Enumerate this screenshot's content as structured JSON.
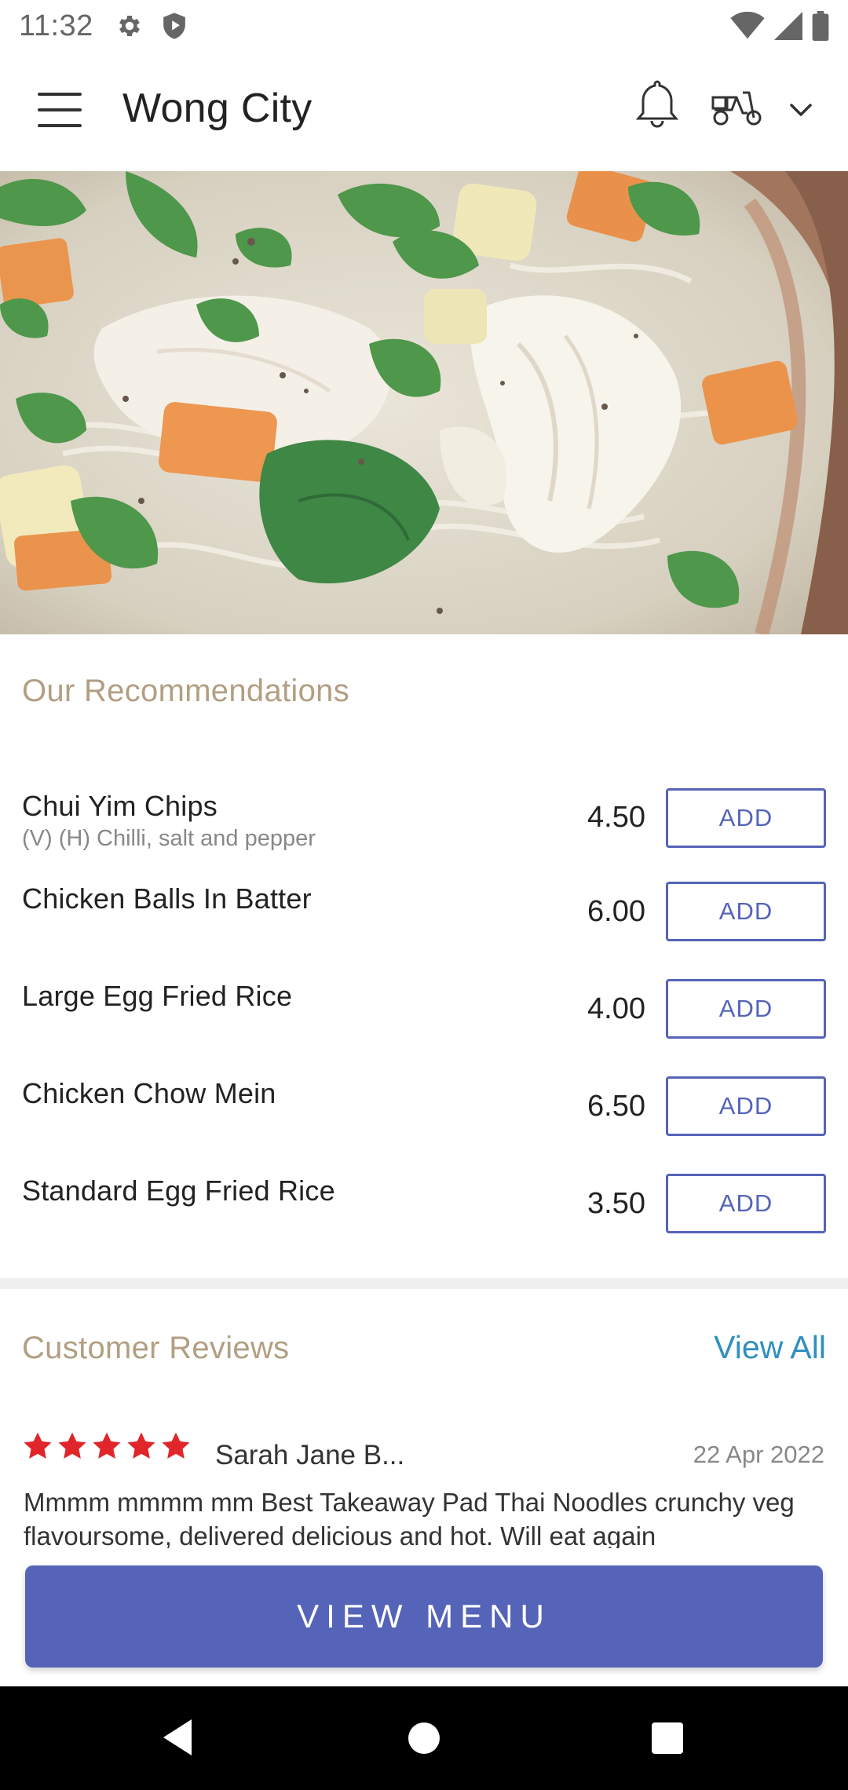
{
  "status_bar": {
    "time": "11:32",
    "left_icons": [
      "gear-icon",
      "shield-icon"
    ],
    "right_icons": [
      "wifi-icon",
      "cellular-signal-icon",
      "battery-icon"
    ]
  },
  "app_bar": {
    "title": "Wong City",
    "icons": [
      "hamburger-menu-icon",
      "bell-icon",
      "scooter-delivery-icon",
      "chevron-down-icon"
    ]
  },
  "hero": {
    "image_description_icon": "chicken-noodle-soup-image"
  },
  "recommendations": {
    "title": "Our Recommendations",
    "add_label": "ADD",
    "items": [
      {
        "name": "Chui Yim Chips",
        "description": "(V) (H) Chilli, salt and pepper",
        "price": "4.50"
      },
      {
        "name": "Chicken Balls In Batter",
        "description": "",
        "price": "6.00"
      },
      {
        "name": "Large Egg Fried Rice",
        "description": "",
        "price": "4.00"
      },
      {
        "name": "Chicken Chow Mein",
        "description": "",
        "price": "6.50"
      },
      {
        "name": "Standard Egg Fried Rice",
        "description": "",
        "price": "3.50"
      }
    ]
  },
  "reviews": {
    "title": "Customer Reviews",
    "view_all_label": "View All",
    "items": [
      {
        "rating": 5,
        "max_rating": 5,
        "author": "Sarah Jane B...",
        "date": "22 Apr 2022",
        "text": "Mmmm mmmm mm Best Takeaway Pad Thai Noodles crunchy veg flavoursome, delivered delicious and hot.   Will eat again"
      }
    ]
  },
  "cta": {
    "view_menu_label": "VIEW MENU"
  },
  "colors": {
    "accent": "#5564b8",
    "section_title": "#b29f82",
    "link": "#2f8fc0",
    "star": "#e0262b"
  },
  "nav_bar": {
    "icons": [
      "back-icon",
      "home-icon",
      "recents-icon"
    ]
  }
}
